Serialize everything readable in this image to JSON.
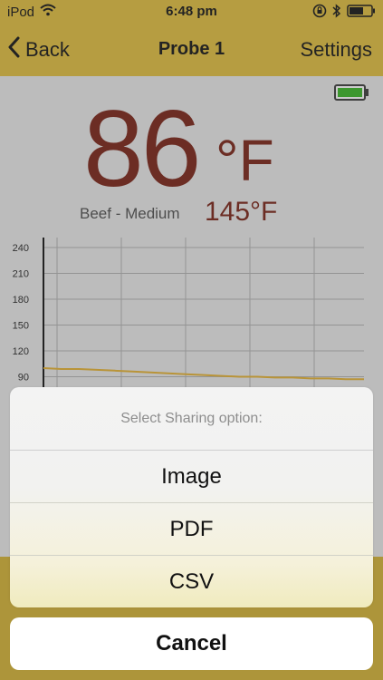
{
  "status_bar": {
    "carrier": "iPod",
    "time": "6:48 pm"
  },
  "nav": {
    "back_label": "Back",
    "title": "Probe 1",
    "settings_label": "Settings"
  },
  "reading": {
    "current_temp": "86",
    "unit": "°F",
    "preset": "Beef - Medium",
    "target_temp": "145°F"
  },
  "chart_data": {
    "type": "line",
    "y_ticks": [
      "240",
      "210",
      "180",
      "150",
      "120",
      "90"
    ],
    "ylim": [
      75,
      250
    ],
    "series": [
      {
        "color": "#c79a2a",
        "values": [
          100,
          99,
          99,
          98,
          97,
          96,
          95,
          94,
          93,
          92,
          91,
          90,
          90,
          89,
          89,
          88,
          88,
          87,
          87
        ]
      }
    ],
    "grid": true
  },
  "action_sheet": {
    "title": "Select Sharing option:",
    "options": [
      {
        "label": "Image"
      },
      {
        "label": "PDF"
      },
      {
        "label": "CSV"
      }
    ],
    "cancel_label": "Cancel"
  },
  "colors": {
    "accent_bar": "#c4a535",
    "temp_text": "#6a1d12",
    "battery_fill": "#2f9e1e"
  }
}
